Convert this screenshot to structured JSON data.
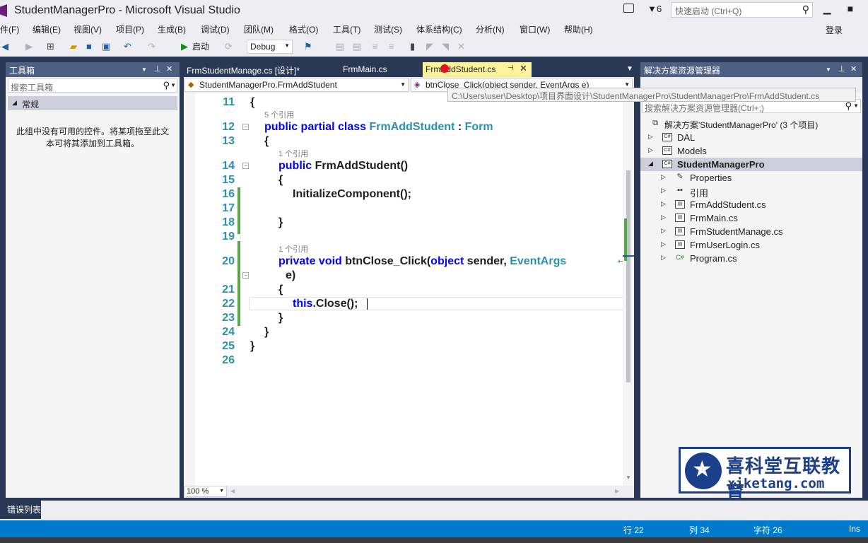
{
  "window": {
    "title": "StudentManagerPro - Microsoft Visual Studio",
    "notification_count": "6",
    "quick_launch_placeholder": "快速启动 (Ctrl+Q)",
    "login": "登录"
  },
  "menu": [
    "件(F)",
    "编辑(E)",
    "视图(V)",
    "项目(P)",
    "生成(B)",
    "调试(D)",
    "团队(M)",
    "格式(O)",
    "工具(T)",
    "测试(S)",
    "体系结构(C)",
    "分析(N)",
    "窗口(W)",
    "帮助(H)"
  ],
  "toolbar": {
    "start_label": "启动",
    "configuration": "Debug"
  },
  "toolbox": {
    "title": "工具箱",
    "search_placeholder": "搜索工具箱",
    "group": "常规",
    "empty_message": "此组中没有可用的控件。将某项拖至此文本可将其添加到工具箱。"
  },
  "tabs": {
    "tab1": "FrmStudentManage.cs [设计]*",
    "tab2": "FrmMain.cs",
    "active": "FrmAddStudent.cs"
  },
  "navbar": {
    "class_dropdown": "StudentManagerPro.FrmAddStudent",
    "member_dropdown": "btnClose_Click(object sender, EventArgs e)",
    "tooltip": "C:\\Users\\user\\Desktop\\项目界面设计\\StudentManagerPro\\StudentManagerPro\\FrmAddStudent.cs"
  },
  "editor": {
    "line_numbers": [
      "11",
      "12",
      "13",
      "14",
      "15",
      "16",
      "17",
      "18",
      "19",
      "20",
      "21",
      "22",
      "23",
      "24",
      "25",
      "26"
    ],
    "refs": {
      "class_refs": "5 个引用",
      "ctor_refs": "1 个引用",
      "method_refs": "1 个引用"
    },
    "code": {
      "l11": "{",
      "l12_kw": "public partial class ",
      "l12_type": "FrmAddStudent",
      "l12_colon": " : ",
      "l12_base": "Form",
      "l13": "{",
      "l14_kw": "public ",
      "l14_name": "FrmAddStudent()",
      "l15": "{",
      "l16": "InitializeComponent();",
      "l18": "}",
      "l20_kw": "private void ",
      "l20_name": "btnClose_Click(",
      "l20_kw2": "object",
      "l20_mid": " sender, ",
      "l20_type": "EventArgs",
      "l20_wrap": "e)",
      "l21": "{",
      "l22_kw": "this",
      "l22_rest": ".Close();",
      "l23": "}",
      "l24": "}",
      "l25": "}"
    },
    "zoom": "100 %"
  },
  "solution_explorer": {
    "title": "解决方案资源管理器",
    "search_placeholder": "搜索解决方案资源管理器(Ctrl+;)",
    "solution": "解决方案'StudentManagerPro' (3 个项目)",
    "items": [
      {
        "label": "DAL",
        "icon": "C#"
      },
      {
        "label": "Models",
        "icon": "C#"
      },
      {
        "label": "StudentManagerPro",
        "icon": "C#"
      },
      {
        "label": "Properties",
        "icon": "wrench"
      },
      {
        "label": "引用",
        "icon": "references"
      },
      {
        "label": "FrmAddStudent.cs",
        "icon": "form"
      },
      {
        "label": "FrmMain.cs",
        "icon": "form"
      },
      {
        "label": "FrmStudentManage.cs",
        "icon": "form"
      },
      {
        "label": "FrmUserLogin.cs",
        "icon": "form"
      },
      {
        "label": "Program.cs",
        "icon": "C#"
      }
    ]
  },
  "watermark": {
    "cn": "喜科堂互联教育",
    "en": "xiketang.com"
  },
  "bottom": {
    "error_list": "错误列表"
  },
  "status": {
    "line": "行 22",
    "col": "列 34",
    "char": "字符 26",
    "mode": "Ins"
  },
  "colors": {
    "accent_blue": "#007acc",
    "panel_header": "#4d6082",
    "frame": "#293955",
    "active_tab": "#fff29d",
    "keyword": "#0000ff",
    "type": "#2b91af"
  }
}
